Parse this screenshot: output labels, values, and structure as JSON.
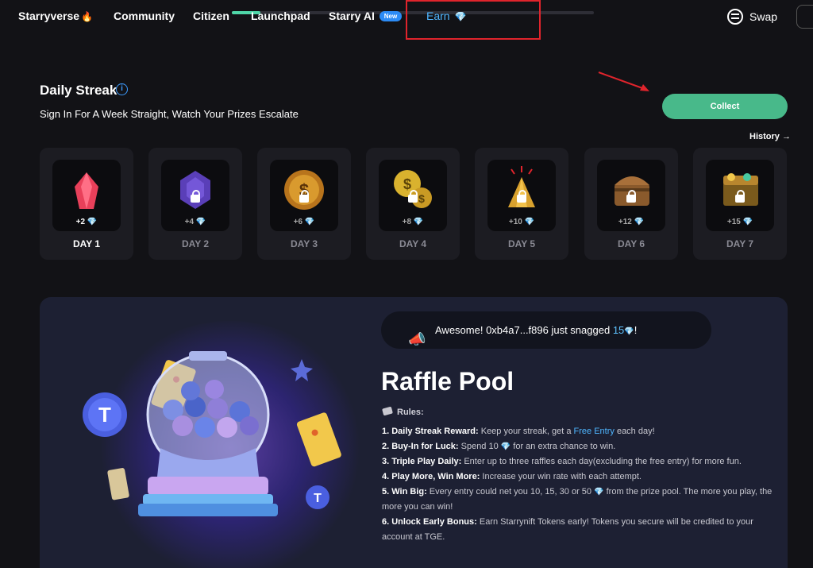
{
  "nav": {
    "items": [
      {
        "label": "Starryverse",
        "emoji": "🔥"
      },
      {
        "label": "Community"
      },
      {
        "label": "Citizen"
      },
      {
        "label": "Launchpad"
      },
      {
        "label": "Starry AI",
        "badge": "New"
      },
      {
        "label": "Earn",
        "emoji": "💎",
        "active": true
      }
    ],
    "swap_label": "Swap"
  },
  "streak": {
    "title": "Daily Streak",
    "info": "i",
    "subtitle": "Sign In For A Week Straight, Watch Your Prizes Escalate",
    "collect_label": "Collect",
    "history_label": "History →",
    "days": [
      {
        "label": "DAY 1",
        "reward": "+2",
        "prize": "red-crystal",
        "locked": false
      },
      {
        "label": "DAY 2",
        "reward": "+4",
        "prize": "purple-gem",
        "locked": true
      },
      {
        "label": "DAY 3",
        "reward": "+6",
        "prize": "gold-coin",
        "locked": true
      },
      {
        "label": "DAY 4",
        "reward": "+8",
        "prize": "coin-stack",
        "locked": true
      },
      {
        "label": "DAY 5",
        "reward": "+10",
        "prize": "gold-bars",
        "locked": true
      },
      {
        "label": "DAY 6",
        "reward": "+12",
        "prize": "treasure-chest",
        "locked": true
      },
      {
        "label": "DAY 7",
        "reward": "+15",
        "prize": "gold-chest",
        "locked": true
      }
    ]
  },
  "raffle": {
    "announce": {
      "text": "Awesome! 0xb4a7...f896 just snagged ",
      "amount": "15",
      "suffix": "!"
    },
    "title": "Raffle Pool",
    "rules_heading": "Rules:",
    "rules": [
      {
        "bold": "1. Daily Streak Reward:",
        "text": " Keep your streak, get a ",
        "link": "Free Entry",
        "after": " each day!"
      },
      {
        "bold": "2. Buy-In for Luck:",
        "text": " Spend 10 ",
        "gem": true,
        "after": " for an extra chance to win."
      },
      {
        "bold": "3. Triple Play Daily:",
        "text": " Enter up to three raffles each day(excluding the free entry) for more fun."
      },
      {
        "bold": "4. Play More, Win More:",
        "text": " Increase your win rate with each attempt."
      },
      {
        "bold": "5. Win Big:",
        "text": " Every entry could net you 10, 15, 30 or 50 ",
        "gem": true,
        "after": " from the prize pool. The more you play, the more you can win!"
      },
      {
        "bold": "6. Unlock Early Bonus:",
        "text": " Earn Starrynift Tokens early! Tokens you secure will be credited to your account at TGE."
      }
    ]
  },
  "colors": {
    "accent": "#4fb6ff",
    "collect": "#48b98a",
    "highlight": "#e0242c"
  },
  "icons": [
    "fire-icon",
    "diamond-icon",
    "swap-icon",
    "info-icon",
    "lock-icon",
    "megaphone-icon",
    "ticket-icon",
    "arrow-right-icon"
  ]
}
